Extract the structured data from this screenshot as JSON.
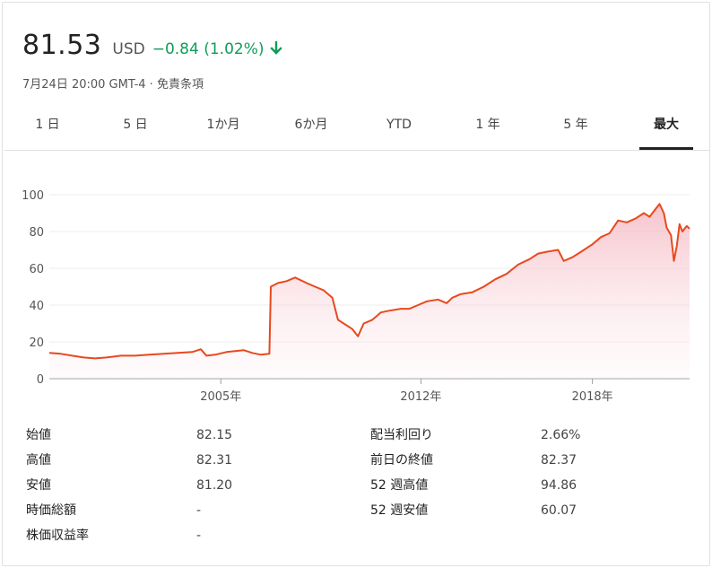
{
  "quote": {
    "price": "81.53",
    "currency": "USD",
    "change": "−0.84 (1.02%)",
    "direction": "down",
    "timestamp": "7月24日 20:00 GMT-4 · 免責条項",
    "up_color": "#0f9d58"
  },
  "tabs": [
    {
      "label": "1 日",
      "active": false
    },
    {
      "label": "5 日",
      "active": false
    },
    {
      "label": "1か月",
      "active": false
    },
    {
      "label": "6か月",
      "active": false
    },
    {
      "label": "YTD",
      "active": false
    },
    {
      "label": "1 年",
      "active": false
    },
    {
      "label": "5 年",
      "active": false
    },
    {
      "label": "最大",
      "active": true
    }
  ],
  "chart_data": {
    "type": "area",
    "line_color": "#e8491d",
    "fill_color": "#f4c5cc",
    "ylim": [
      0,
      100
    ],
    "yticks": [
      0,
      20,
      40,
      60,
      80,
      100
    ],
    "xlim": [
      1999.0,
      2020.6
    ],
    "xticks": [
      {
        "x": 2005,
        "label": "2005年"
      },
      {
        "x": 2012,
        "label": "2012年"
      },
      {
        "x": 2018,
        "label": "2018年"
      }
    ],
    "grid": true,
    "series": [
      {
        "points": [
          [
            1999.0,
            14
          ],
          [
            1999.4,
            13.5
          ],
          [
            1999.8,
            12.5
          ],
          [
            2000.2,
            11.5
          ],
          [
            2000.6,
            11
          ],
          [
            2001.0,
            11.5
          ],
          [
            2001.5,
            12.5
          ],
          [
            2002.0,
            12.5
          ],
          [
            2002.5,
            13
          ],
          [
            2003.0,
            13.5
          ],
          [
            2003.5,
            14
          ],
          [
            2004.0,
            14.5
          ],
          [
            2004.3,
            16
          ],
          [
            2004.5,
            12.5
          ],
          [
            2004.8,
            13
          ],
          [
            2005.2,
            14.5
          ],
          [
            2005.5,
            15
          ],
          [
            2005.8,
            15.5
          ],
          [
            2006.1,
            14
          ],
          [
            2006.4,
            13
          ],
          [
            2006.7,
            13.5
          ],
          [
            2006.75,
            50
          ],
          [
            2007.0,
            52
          ],
          [
            2007.3,
            53
          ],
          [
            2007.6,
            55
          ],
          [
            2008.0,
            52
          ],
          [
            2008.3,
            50
          ],
          [
            2008.6,
            48
          ],
          [
            2008.9,
            44
          ],
          [
            2009.1,
            32
          ],
          [
            2009.3,
            30
          ],
          [
            2009.6,
            27
          ],
          [
            2009.8,
            23
          ],
          [
            2010.0,
            30
          ],
          [
            2010.3,
            32
          ],
          [
            2010.6,
            36
          ],
          [
            2010.9,
            37
          ],
          [
            2011.3,
            38
          ],
          [
            2011.6,
            38
          ],
          [
            2011.9,
            40
          ],
          [
            2012.2,
            42
          ],
          [
            2012.6,
            43
          ],
          [
            2012.9,
            41
          ],
          [
            2013.1,
            44
          ],
          [
            2013.4,
            46
          ],
          [
            2013.8,
            47
          ],
          [
            2014.2,
            50
          ],
          [
            2014.6,
            54
          ],
          [
            2015.0,
            57
          ],
          [
            2015.4,
            62
          ],
          [
            2015.8,
            65
          ],
          [
            2016.1,
            68
          ],
          [
            2016.4,
            69
          ],
          [
            2016.8,
            70
          ],
          [
            2017.0,
            64
          ],
          [
            2017.3,
            66
          ],
          [
            2017.6,
            69
          ],
          [
            2018.0,
            73
          ],
          [
            2018.3,
            77
          ],
          [
            2018.6,
            79
          ],
          [
            2018.9,
            86
          ],
          [
            2019.2,
            85
          ],
          [
            2019.5,
            87
          ],
          [
            2019.8,
            90
          ],
          [
            2020.0,
            88
          ],
          [
            2020.2,
            92
          ],
          [
            2020.35,
            95
          ],
          [
            2020.5,
            90
          ],
          [
            2020.6,
            82
          ],
          [
            2020.75,
            78
          ],
          [
            2020.85,
            64
          ],
          [
            2020.95,
            72
          ],
          [
            2021.05,
            84
          ],
          [
            2021.15,
            80
          ],
          [
            2021.3,
            83
          ],
          [
            2021.4,
            81.53
          ]
        ]
      }
    ]
  },
  "stats": [
    {
      "label": "始値",
      "value": "82.15"
    },
    {
      "label": "高値",
      "value": "82.31"
    },
    {
      "label": "安値",
      "value": "81.20"
    },
    {
      "label": "時価総額",
      "value": "-"
    },
    {
      "label": "株価収益率",
      "value": "-"
    },
    {
      "label": "配当利回り",
      "value": "2.66%"
    },
    {
      "label": "前日の終値",
      "value": "82.37"
    },
    {
      "label": "52 週高値",
      "value": "94.86"
    },
    {
      "label": "52 週安値",
      "value": "60.07"
    }
  ]
}
